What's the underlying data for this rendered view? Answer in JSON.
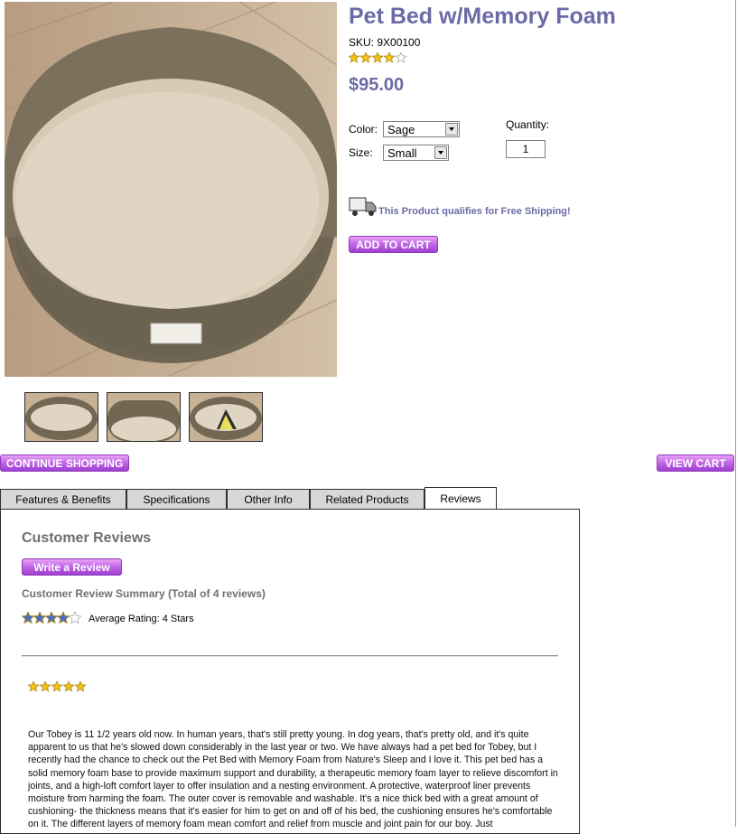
{
  "product": {
    "title": "Pet Bed w/Memory Foam",
    "sku": "SKU: 9X00100",
    "rating_small": 4,
    "price": "$95.00"
  },
  "options": {
    "color_label": "Color:",
    "color_value": "Sage",
    "size_label": "Size:",
    "size_value": "Small",
    "quantity_label": "Quantity:",
    "quantity_value": "1"
  },
  "shipping": {
    "text": "This Product qualifies for Free Shipping!",
    "icon": "truck-icon"
  },
  "buttons": {
    "add_to_cart": "ADD TO CART",
    "continue_shopping": "CONTINUE SHOPPING",
    "view_cart": "VIEW CART",
    "write_review": "Write a Review"
  },
  "tabs": [
    "Features & Benefits",
    "Specifications",
    "Other Info",
    "Related Products",
    "Reviews"
  ],
  "active_tab": "Reviews",
  "reviews": {
    "heading": "Customer Reviews",
    "summary": "Customer Review Summary (Total of 4 reviews)",
    "average_rating": 4,
    "average_text": "Average Rating: 4 Stars",
    "first_review_rating": 5,
    "first_review_text": "Our Tobey is 11 1/2 years old now. In human years, that's still pretty young. In dog years, that's pretty old, and it's quite apparent to us that he's slowed down considerably in the last year or two. We have always had a pet bed for Tobey, but I recently had the chance to check out the Pet Bed with Memory Foam from Nature's Sleep and I love it. This pet bed has a solid memory foam base to provide maximum support and durability, a therapeutic memory foam layer to relieve discomfort in joints, and a high-loft comfort layer to offer insulation and a nesting environment. A protective, waterproof liner prevents moisture from harming the foam. The outer cover is removable and washable. It's a nice thick bed with a great amount of cushioning- the thickness means that it's easier for him to get on and off of his bed, the cushioning ensures he's comfortable on it. The different layers of memory foam mean comfort and relief from muscle and joint pain for our boy. Just"
  },
  "colors": {
    "title": "#6b6aa6",
    "button": "#b45be0",
    "star_gold": "#f3c417",
    "star_blue": "#4a6fc0"
  }
}
